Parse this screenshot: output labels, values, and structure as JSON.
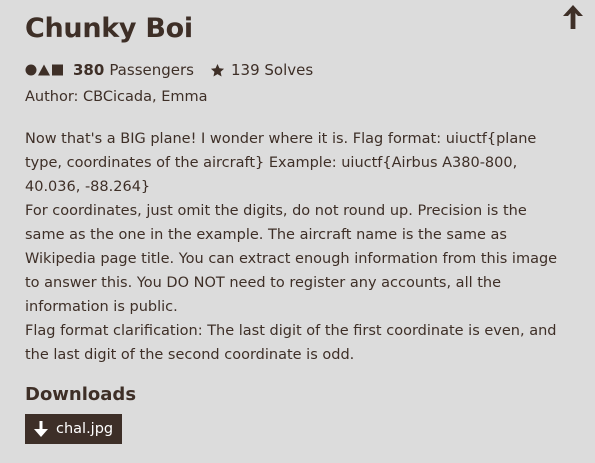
{
  "challenge": {
    "title": "Chunky Boi",
    "passengers_count": "380",
    "passengers_label": "Passengers",
    "solves_count": "139",
    "solves_label": "Solves",
    "author": "Author: CBCicada, Emma",
    "description": [
      "Now that's a BIG plane! I wonder where it is. Flag format: uiuctf{plane type, coordinates of the aircraft} Example: uiuctf{Airbus A380-800, 40.036, -88.264}",
      "For coordinates, just omit the digits, do not round up. Precision is the same as the one in the example. The aircraft name is the same as Wikipedia page title. You can extract enough information from this image to answer this. You DO NOT need to register any accounts, all the information is public.",
      "Flag format clarification: The last digit of the first coordinate is even, and the last digit of the second coordinate is odd."
    ]
  },
  "downloads": {
    "heading": "Downloads",
    "files": [
      {
        "name": "chal.jpg",
        "icon": "download-arrow-icon"
      }
    ]
  },
  "icons": {
    "category": "shapes-icon",
    "solves": "star-icon",
    "back_to_top": "arrow-up-icon"
  },
  "colors": {
    "background": "#dcdcdc",
    "text": "#3e2f27",
    "button_bg": "#3d2f28",
    "button_text": "#ffffff"
  }
}
